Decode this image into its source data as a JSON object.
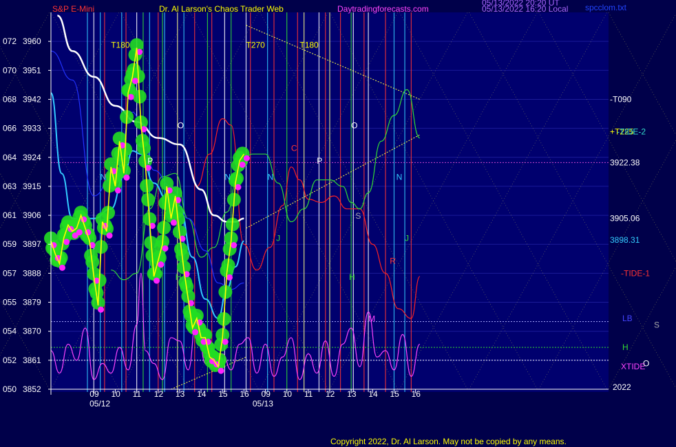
{
  "header": {
    "instrument": "S&P E-Mini",
    "site_title": "Dr. Al Larson's Chaos Trader Web",
    "site_url": "Daytradingforecasts.com",
    "timestamp_1": "05/13/2022 20:20 UT",
    "timestamp_2": "05/13/2022 16:20 Local",
    "file_name": "spcclom.txt"
  },
  "copyright": "Copyright 2022, Dr. Al Larson. May not be copied by any means.",
  "colors": {
    "background": "#00004a",
    "plot_background": "#00006e",
    "price_line": "#ffff00",
    "green_dots": "#22dd22",
    "magenta_dots": "#ff22ff",
    "white_ma": "#ffffff",
    "cyan_ma": "#33ccff",
    "blue_ma": "#2233ff",
    "tide1": "#ff2222",
    "tide2": "#33dd33",
    "xtide": "#ff44ff"
  },
  "chart_data": {
    "type": "line",
    "title": "S&P E-Mini",
    "y_ticks": [
      {
        "left": "050",
        "price": "3852",
        "value": 3852
      },
      {
        "left": "052",
        "price": "3861",
        "value": 3861
      },
      {
        "left": "054",
        "price": "3870",
        "value": 3870
      },
      {
        "left": "055",
        "price": "3879",
        "value": 3879
      },
      {
        "left": "057",
        "price": "3888",
        "value": 3888
      },
      {
        "left": "059",
        "price": "3897",
        "value": 3897
      },
      {
        "left": "061",
        "price": "3906",
        "value": 3906
      },
      {
        "left": "063",
        "price": "3915",
        "value": 3915
      },
      {
        "left": "064",
        "price": "3924",
        "value": 3924
      },
      {
        "left": "066",
        "price": "3933",
        "value": 3933
      },
      {
        "left": "068",
        "price": "3942",
        "value": 3942
      },
      {
        "left": "070",
        "price": "3951",
        "value": 3951
      },
      {
        "left": "072",
        "price": "3960",
        "value": 3960
      }
    ],
    "ylim": [
      3852,
      3969
    ],
    "xlim": [
      7.0,
      33.0
    ],
    "x_ticks": [
      {
        "label": "09",
        "x": 9
      },
      {
        "label": "10",
        "x": 10
      },
      {
        "label": "11",
        "x": 11
      },
      {
        "label": "12",
        "x": 12
      },
      {
        "label": "13",
        "x": 13
      },
      {
        "label": "14",
        "x": 14
      },
      {
        "label": "15",
        "x": 15
      },
      {
        "label": "16",
        "x": 16
      },
      {
        "label": "09",
        "x": 17
      },
      {
        "label": "10",
        "x": 18
      },
      {
        "label": "11",
        "x": 19
      },
      {
        "label": "12",
        "x": 20
      },
      {
        "label": "13",
        "x": 21
      },
      {
        "label": "14",
        "x": 22
      },
      {
        "label": "15",
        "x": 23
      },
      {
        "label": "16",
        "x": 24
      }
    ],
    "dates": [
      {
        "label": "05/12",
        "x": 8.8
      },
      {
        "label": "05/13",
        "x": 16.4
      }
    ],
    "year_label": "2022",
    "price_series": {
      "x": [
        7.0,
        7.2,
        7.4,
        7.6,
        7.8,
        8.0,
        8.2,
        8.4,
        8.6,
        8.8,
        9.0,
        9.2,
        9.4,
        9.6,
        9.8,
        10.0,
        10.2,
        10.4,
        10.6,
        10.8,
        11.0,
        11.2,
        11.4,
        11.6,
        11.8,
        12.0,
        12.2,
        12.4,
        12.6,
        12.8,
        13.0,
        13.2,
        13.4,
        13.6,
        13.8,
        14.0,
        14.2,
        14.4,
        14.6,
        14.8,
        15.0,
        15.2,
        15.4,
        15.6,
        15.8,
        16.0
      ],
      "y": [
        3898,
        3894,
        3891,
        3899,
        3903,
        3901,
        3902,
        3906,
        3902,
        3898,
        3887,
        3878,
        3904,
        3901,
        3921,
        3915,
        3929,
        3919,
        3944,
        3949,
        3958,
        3934,
        3922,
        3904,
        3887,
        3892,
        3897,
        3915,
        3905,
        3912,
        3900,
        3889,
        3880,
        3871,
        3874,
        3868,
        3868,
        3862,
        3861,
        3859,
        3868,
        3888,
        3898,
        3916,
        3923,
        3925
      ]
    },
    "moving_averages": [
      {
        "name": "white",
        "x": [
          7.3,
          8.0,
          9.0,
          10.0,
          11.0,
          12.0,
          13.0,
          14.0,
          14.6,
          15.2,
          15.6,
          16.0
        ],
        "y": [
          3968,
          3957,
          3949,
          3940,
          3935,
          3930,
          3928,
          3914,
          3906,
          3904,
          3904,
          3905
        ]
      },
      {
        "name": "cyan",
        "x": [
          7.0,
          7.5,
          8.0,
          9.0,
          9.8,
          10.4,
          10.8,
          11.2,
          11.8,
          12.4,
          13.0,
          13.6,
          14.2,
          14.8,
          15.2,
          15.6,
          16.0
        ],
        "y": [
          3944,
          3919,
          3905,
          3905,
          3908,
          3918,
          3926,
          3925,
          3916,
          3911,
          3909,
          3893,
          3880,
          3874,
          3883,
          3890,
          3898
        ]
      },
      {
        "name": "blue",
        "x": [
          7.0,
          8.0,
          9.0,
          10.0,
          10.8,
          11.2,
          11.8,
          12.6,
          13.4,
          14.2,
          14.8,
          15.4,
          16.0
        ],
        "y": [
          3957,
          3948,
          3912,
          3920,
          3938,
          3935,
          3920,
          3915,
          3905,
          3895,
          3885,
          3883,
          3885
        ]
      }
    ],
    "tide1": {
      "name": "-TIDE-1",
      "x": [
        13.8,
        14.4,
        15.0,
        15.4,
        16.0,
        16.6,
        17.2,
        17.8,
        18.2,
        18.6,
        19.0,
        19.6,
        20.2,
        20.8,
        21.4,
        22.0,
        22.6,
        23.2,
        23.8,
        24.2
      ],
      "y": [
        3915,
        3925,
        3936,
        3934,
        3897,
        3889,
        3896,
        3909,
        3921,
        3917,
        3911,
        3910,
        3912,
        3908,
        3908,
        3897,
        3888,
        3877,
        3874,
        3887
      ]
    },
    "tide2": {
      "name": "-TIDE-2",
      "x": [
        9.8,
        10.4,
        11.0,
        11.6,
        12.2,
        12.8,
        13.4,
        14.0,
        14.6,
        15.2,
        15.8,
        16.4,
        17.0,
        17.6,
        18.2,
        18.8,
        19.4,
        20.0,
        20.6,
        21.0,
        21.4,
        21.8,
        22.4,
        23.0,
        23.6,
        24.2
      ],
      "y": [
        3889,
        3886,
        3888,
        3908,
        3918,
        3919,
        3905,
        3893,
        3896,
        3907,
        3922,
        3925,
        3925,
        3916,
        3904,
        3908,
        3917,
        3917,
        3915,
        3910,
        3908,
        3913,
        3929,
        3937,
        3945,
        3930
      ]
    },
    "xtide": {
      "name": "XTIDE",
      "x": [
        7.0,
        7.4,
        7.8,
        8.2,
        8.6,
        9.0,
        9.4,
        9.8,
        10.2,
        10.6,
        11.0,
        11.2,
        11.4,
        11.8,
        12.2,
        12.6,
        13.0,
        13.4,
        13.8,
        14.2,
        14.6,
        15.0,
        15.4,
        15.8,
        16.2,
        16.6,
        17.0,
        17.4,
        17.8,
        18.2,
        18.6,
        19.0,
        19.4,
        19.8,
        20.2,
        20.6,
        21.0,
        21.4,
        21.8,
        22.2,
        22.6,
        23.0,
        23.4,
        23.8,
        24.2
      ],
      "y": [
        3864,
        3857,
        3866,
        3861,
        3871,
        3855,
        3860,
        3857,
        3865,
        3858,
        3872,
        3888,
        3864,
        3860,
        3855,
        3868,
        3867,
        3858,
        3875,
        3860,
        3862,
        3863,
        3858,
        3866,
        3868,
        3857,
        3866,
        3856,
        3862,
        3868,
        3855,
        3863,
        3857,
        3867,
        3856,
        3866,
        3871,
        3859,
        3876,
        3862,
        3864,
        3858,
        3869,
        3856,
        3866
      ]
    },
    "horizontal_levels": [
      {
        "label": "3922.38",
        "value": 3922.38,
        "color": "#cc44cc",
        "style": "dotted"
      },
      {
        "label": "3905.06",
        "value": 3905.06,
        "color": "#ffffff",
        "style": "none"
      },
      {
        "label": "3898.31",
        "value": 3898.31,
        "color": "#33ccff",
        "style": "none"
      },
      {
        "label": "LB",
        "value": 3873,
        "color": "#aaaaff",
        "style": "dotted"
      },
      {
        "label": "H",
        "value": 3865,
        "color": "#33dd33",
        "style": "dotted"
      },
      {
        "label": "XTIDE",
        "value": 3861,
        "color": "#ffffff",
        "style": "dotted"
      }
    ],
    "right_labels": [
      {
        "text": "-T090",
        "value": 3942,
        "color": "#ffffff"
      },
      {
        "text": "+T225",
        "value": 3932,
        "color": "#ffff00"
      },
      {
        "text": "-TIDE-2",
        "value": 3932,
        "color": "#33ddcc"
      },
      {
        "text": "3922.38",
        "value": 3922.38,
        "color": "#ffffff"
      },
      {
        "text": "3905.06",
        "value": 3905.06,
        "color": "#ffffff"
      },
      {
        "text": "3898.31",
        "value": 3898.31,
        "color": "#33ccff"
      },
      {
        "text": "-TIDE-1",
        "value": 3888,
        "color": "#ff3333"
      },
      {
        "text": "LB",
        "value": 3874,
        "color": "#4444ff"
      },
      {
        "text": "S",
        "value": 3872,
        "color": "#aaaaaa"
      },
      {
        "text": "H",
        "value": 3865,
        "color": "#33dd33"
      },
      {
        "text": "O",
        "value": 3860,
        "color": "#ffffff"
      },
      {
        "text": "XTIDE",
        "value": 3859,
        "color": "#ff44ff"
      }
    ],
    "chart_letters": [
      {
        "text": "T180",
        "x": 9.8,
        "y": 3958,
        "color": "#ffff00"
      },
      {
        "text": "T270",
        "x": 16.1,
        "y": 3958,
        "color": "#ffff00"
      },
      {
        "text": "T180",
        "x": 18.6,
        "y": 3958,
        "color": "#ffff00"
      },
      {
        "text": "O",
        "x": 12.9,
        "y": 3933,
        "color": "#ffffff"
      },
      {
        "text": "O",
        "x": 21.0,
        "y": 3933,
        "color": "#ffffff"
      },
      {
        "text": "P",
        "x": 11.5,
        "y": 3922,
        "color": "#ffffff"
      },
      {
        "text": "P",
        "x": 19.4,
        "y": 3922,
        "color": "#ffffff"
      },
      {
        "text": "C",
        "x": 18.2,
        "y": 3926,
        "color": "#ff3333"
      },
      {
        "text": "N",
        "x": 9.3,
        "y": 3917,
        "color": "#33ccff"
      },
      {
        "text": "N",
        "x": 15.1,
        "y": 3917,
        "color": "#33ccff"
      },
      {
        "text": "N",
        "x": 17.1,
        "y": 3917,
        "color": "#33ccff"
      },
      {
        "text": "N",
        "x": 23.1,
        "y": 3917,
        "color": "#33ccff"
      },
      {
        "text": "S",
        "x": 21.2,
        "y": 3905,
        "color": "#aaaaaa"
      },
      {
        "text": "J",
        "x": 17.5,
        "y": 3898,
        "color": "#33dd33"
      },
      {
        "text": "J",
        "x": 23.5,
        "y": 3898,
        "color": "#33dd33"
      },
      {
        "text": "R",
        "x": 22.8,
        "y": 3891,
        "color": "#ff3333"
      },
      {
        "text": "H",
        "x": 12.8,
        "y": 3886,
        "color": "#33dd33"
      },
      {
        "text": "H",
        "x": 20.9,
        "y": 3886,
        "color": "#33dd33"
      },
      {
        "text": "M",
        "x": 21.8,
        "y": 3873,
        "color": "#ff44ff"
      }
    ],
    "vertical_lines": [
      {
        "x": 8.7,
        "color": "#33ccff"
      },
      {
        "x": 9.0,
        "color": "#ffffff"
      },
      {
        "x": 9.3,
        "color": "#33ccff"
      },
      {
        "x": 9.5,
        "color": "#ff3333"
      },
      {
        "x": 10.3,
        "color": "#33ccff"
      },
      {
        "x": 10.5,
        "color": "#ff3333"
      },
      {
        "x": 11.0,
        "color": "#ffffff"
      },
      {
        "x": 11.3,
        "color": "#33dd33"
      },
      {
        "x": 11.6,
        "color": "#33ccff"
      },
      {
        "x": 12.0,
        "color": "#ff3333"
      },
      {
        "x": 12.2,
        "color": "#33dd33"
      },
      {
        "x": 12.3,
        "color": "#33ccff"
      },
      {
        "x": 12.9,
        "color": "#ffff88"
      },
      {
        "x": 13.2,
        "color": "#33ccff"
      },
      {
        "x": 13.7,
        "color": "#ff3333"
      },
      {
        "x": 14.3,
        "color": "#33dd33"
      },
      {
        "x": 14.5,
        "color": "#ff3333"
      },
      {
        "x": 15.1,
        "color": "#ffffff"
      },
      {
        "x": 15.4,
        "color": "#33dd33"
      },
      {
        "x": 16.1,
        "color": "#ffffff"
      },
      {
        "x": 16.3,
        "color": "#ff3333"
      },
      {
        "x": 17.1,
        "color": "#33ccff"
      },
      {
        "x": 17.4,
        "color": "#ff3333"
      },
      {
        "x": 18.0,
        "color": "#33dd33"
      },
      {
        "x": 18.5,
        "color": "#ff3333"
      },
      {
        "x": 18.8,
        "color": "#ffff88"
      },
      {
        "x": 19.5,
        "color": "#ffffff"
      },
      {
        "x": 19.8,
        "color": "#ff3333"
      },
      {
        "x": 20.0,
        "color": "#ffff88"
      },
      {
        "x": 20.5,
        "color": "#ff3333"
      },
      {
        "x": 21.0,
        "color": "#33dd33"
      },
      {
        "x": 21.1,
        "color": "#ffffff"
      },
      {
        "x": 21.6,
        "color": "#ff3333"
      },
      {
        "x": 21.8,
        "color": "#ffffff"
      },
      {
        "x": 22.6,
        "color": "#ff3333"
      },
      {
        "x": 23.0,
        "color": "#33ccff"
      },
      {
        "x": 23.5,
        "color": "#33ccff"
      },
      {
        "x": 23.8,
        "color": "#ff3333"
      }
    ],
    "grid": true
  }
}
